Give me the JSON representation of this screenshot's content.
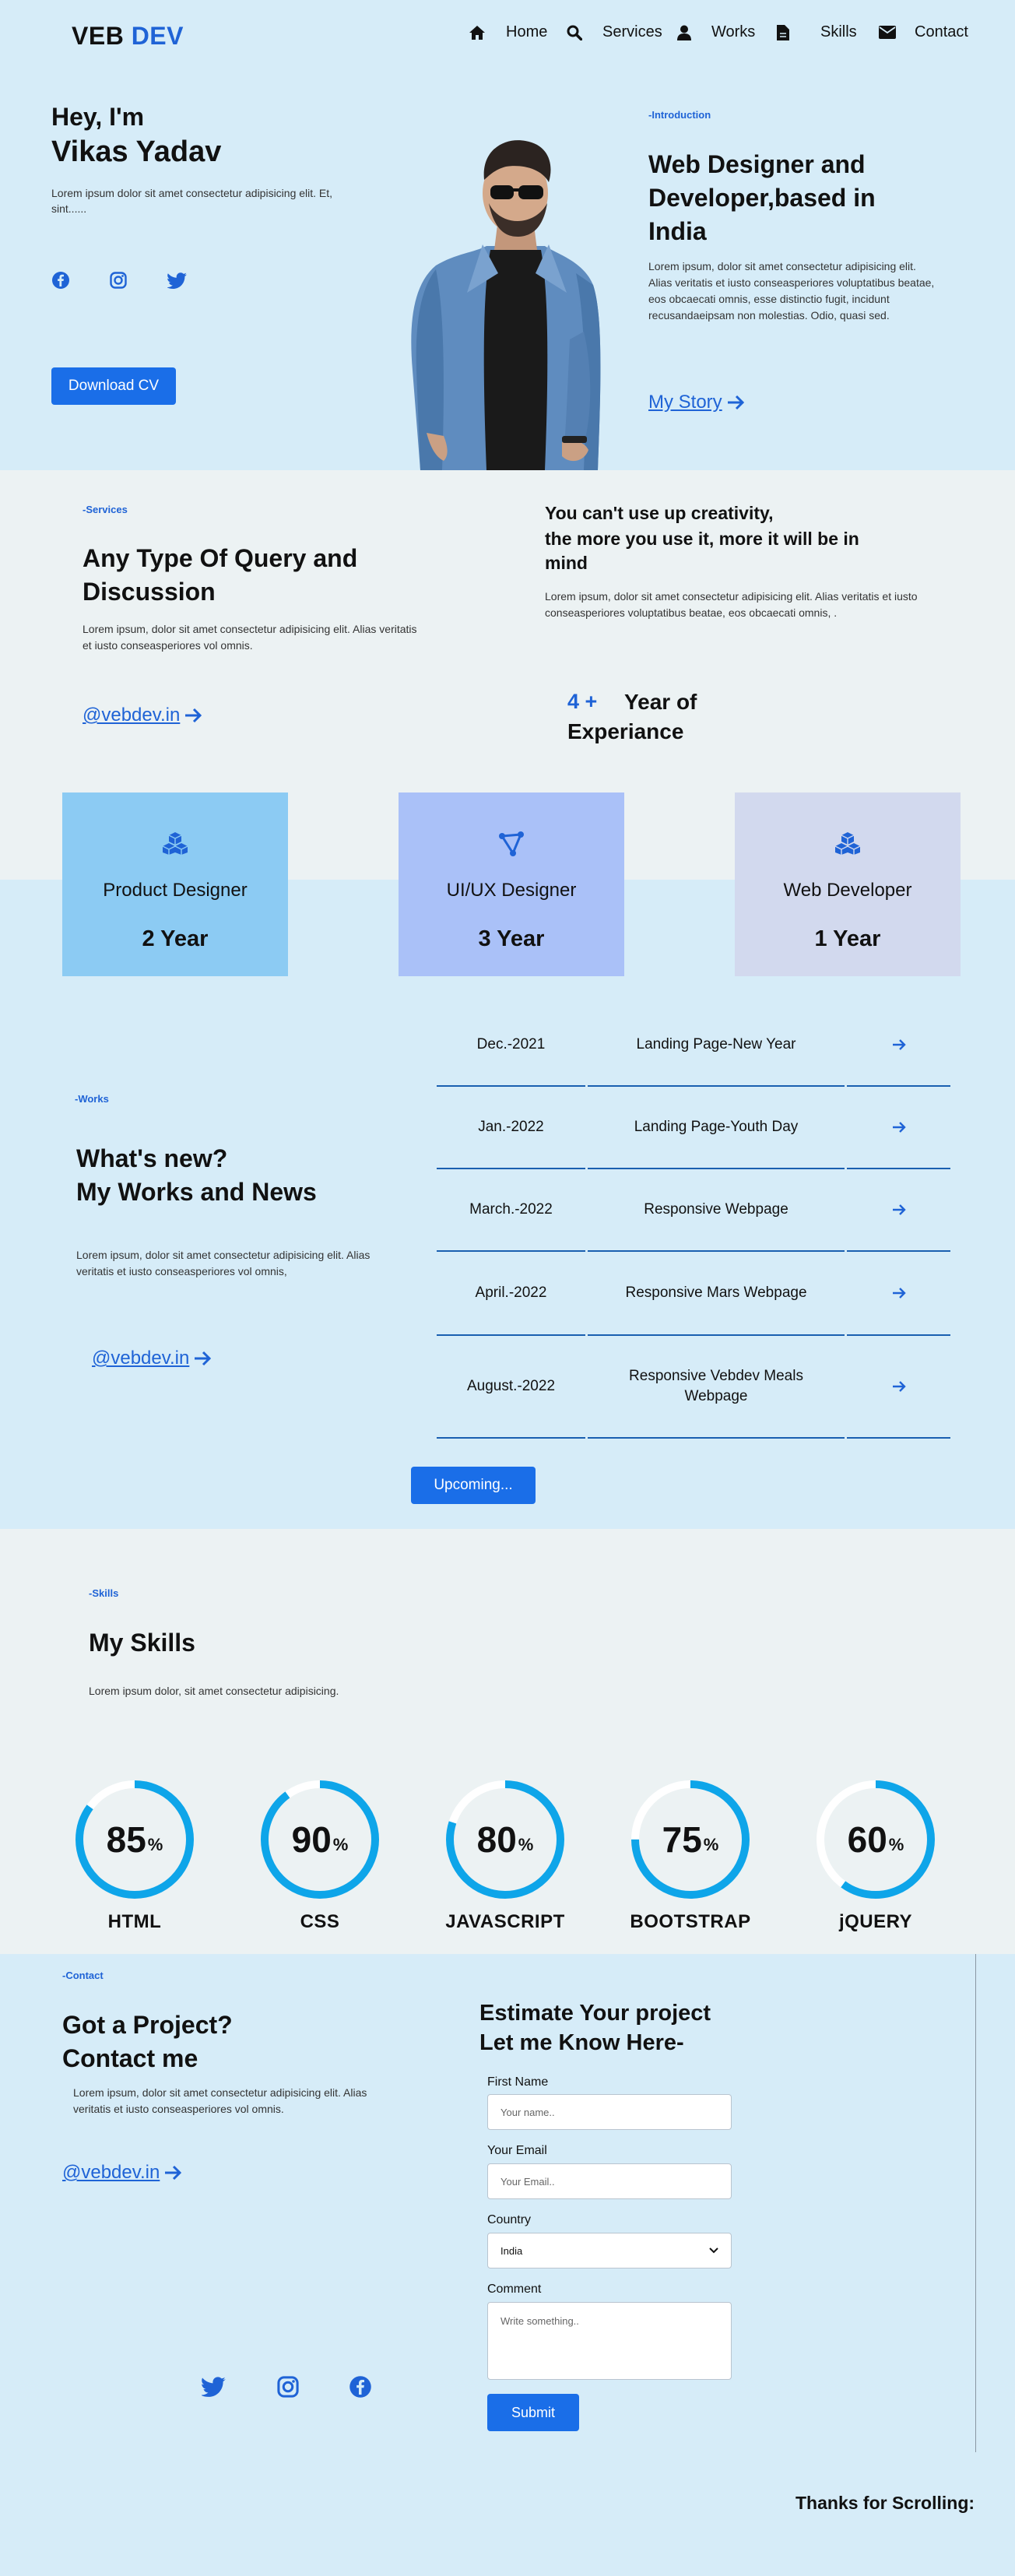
{
  "header": {
    "logo_first": "VEB",
    "logo_second": "DEV",
    "nav": [
      {
        "label": "Home",
        "icon": "home-icon"
      },
      {
        "label": "Services",
        "icon": "search-icon"
      },
      {
        "label": "Works",
        "icon": "user-icon"
      },
      {
        "label": "Skills",
        "icon": "file-icon"
      },
      {
        "label": "Contact",
        "icon": "envelope-icon"
      }
    ]
  },
  "hero": {
    "greeting": "Hey, I'm",
    "name": "Vikas Yadav",
    "text": "Lorem ipsum dolor sit amet consectetur adipisicing elit. Et, sint......",
    "socials": [
      "facebook-icon",
      "instagram-icon",
      "twitter-icon"
    ],
    "download_label": "Download CV",
    "tag": "-Introduction",
    "title": "Web Designer and Developer,based in India",
    "description": "Lorem ipsum, dolor sit amet consectetur adipisicing elit. Alias veritatis et iusto conseasperiores voluptatibus beatae, eos obcaecati omnis, esse distinctio fugit, incidunt recusandaeipsam non molestias. Odio, quasi sed.",
    "story_label": "My Story"
  },
  "services": {
    "tag": "-Services",
    "title": "Any Type Of Query and Discussion",
    "text": "Lorem ipsum, dolor sit amet consectetur adipisicing elit. Alias veritatis et iusto conseasperiores vol omnis.",
    "link": "@vebdev.in",
    "quote_line1": "You can't use up creativity,",
    "quote_line2": "the more you use it, more it will be in mind",
    "quote_text": "Lorem ipsum, dolor sit amet consectetur adipisicing elit. Alias veritatis et iusto conseasperiores voluptatibus beatae, eos obcaecati omnis, .",
    "experience_number": "4 +",
    "experience_label1": "Year of",
    "experience_label2": "Experiance",
    "cards": [
      {
        "title": "Product Designer",
        "years": "2 Year",
        "color": "#8ccbf3",
        "icon": "cubes-icon"
      },
      {
        "title": "UI/UX Designer",
        "years": "3 Year",
        "color": "#aac1f8",
        "icon": "vector-icon"
      },
      {
        "title": "Web Developer",
        "years": "1 Year",
        "color": "#d2d9ee",
        "icon": "cubes-icon"
      }
    ]
  },
  "works": {
    "tag": "-Works",
    "title1": "What's new?",
    "title2": "My Works and News",
    "text": "Lorem ipsum, dolor sit amet consectetur adipisicing elit. Alias veritatis et iusto conseasperiores vol omnis,",
    "link": "@vebdev.in",
    "rows": [
      {
        "date": "Dec.-2021",
        "project": "Landing Page-New Year"
      },
      {
        "date": "Jan.-2022",
        "project": "Landing Page-Youth Day"
      },
      {
        "date": "March.-2022",
        "project": "Responsive Webpage"
      },
      {
        "date": "April.-2022",
        "project": "Responsive Mars Webpage"
      },
      {
        "date": "August.-2022",
        "project": "Responsive Vebdev Meals Webpage"
      }
    ],
    "upcoming_label": "Upcoming..."
  },
  "skills": {
    "tag": "-Skills",
    "title": "My Skills",
    "text": "Lorem ipsum dolor, sit amet consectetur adipisicing.",
    "items": [
      {
        "name": "HTML",
        "value": "85",
        "unit": "%",
        "fraction": 0.85
      },
      {
        "name": "CSS",
        "value": "90",
        "unit": "%",
        "fraction": 0.9
      },
      {
        "name": "JAVASCRIPT",
        "value": "80",
        "unit": "%",
        "fraction": 0.8
      },
      {
        "name": "BOOTSTRAP",
        "value": "75",
        "unit": "%",
        "fraction": 0.75
      },
      {
        "name": "jQUERY",
        "value": "60",
        "unit": "%",
        "fraction": 0.6
      }
    ]
  },
  "contact": {
    "tag": "-Contact",
    "title1": "Got a Project?",
    "title2": "Contact me",
    "text": "Lorem ipsum, dolor sit amet consectetur adipisicing elit. Alias veritatis et iusto conseasperiores vol omnis.",
    "link": "@vebdev.in",
    "socials": [
      "twitter-icon",
      "instagram-icon",
      "facebook-icon"
    ],
    "form_title1": "Estimate Your project",
    "form_title2": "Let me Know Here-",
    "first_name_label": "First Name",
    "first_name_placeholder": "Your name..",
    "email_label": "Your Email",
    "email_placeholder": "Your Email..",
    "country_label": "Country",
    "country_value": "India",
    "comment_label": "Comment",
    "comment_placeholder": "Write something..",
    "submit_label": "Submit",
    "thanks": "Thanks for Scrolling:"
  },
  "colors": {
    "accent": "#1a6ee8",
    "light_bg": "#d6ecf8",
    "grey_bg": "#ecf2f3",
    "ring": "#0ea5e9"
  }
}
